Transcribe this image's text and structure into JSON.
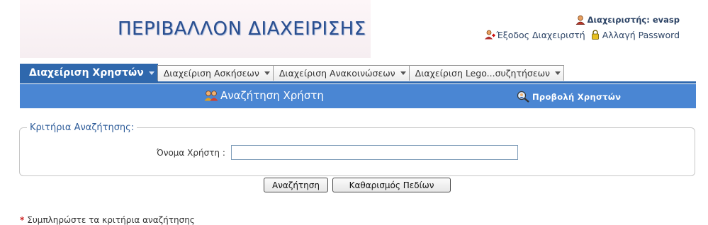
{
  "header": {
    "title": "ΠΕΡΙΒΑΛΛΟΝ ΔΙΑΧΕΙΡΙΣΗΣ",
    "admin_label": "Διαχειριστής: evasp",
    "logout_label": "Έξοδος Διαχειριστή",
    "change_password_label": "Αλλαγή Password"
  },
  "tabs": [
    {
      "label": "Διαχείριση Χρηστών",
      "active": true
    },
    {
      "label": "Διαχείριση Ασκήσεων",
      "active": false
    },
    {
      "label": "Διαχείριση Ανακοινώσεων",
      "active": false
    },
    {
      "label": "Διαχείριση Lego...συζητήσεων",
      "active": false
    }
  ],
  "toolbar": {
    "search_user": "Αναζήτηση Χρήστη",
    "view_users": "Προβολή Χρηστών"
  },
  "search_form": {
    "legend": "Κριτήρια Αναζήτησης:",
    "username_label": "Όνομα Χρήστη :",
    "username_value": ""
  },
  "buttons": {
    "search": "Αναζήτηση",
    "clear": "Καθαρισμός Πεδίων"
  },
  "footer": {
    "note": "Συμπληρώστε τα κριτήρια αναζήτησης"
  },
  "colors": {
    "accent": "#2f68ad",
    "bar": "#4a86d3",
    "title": "#2a4f90"
  }
}
